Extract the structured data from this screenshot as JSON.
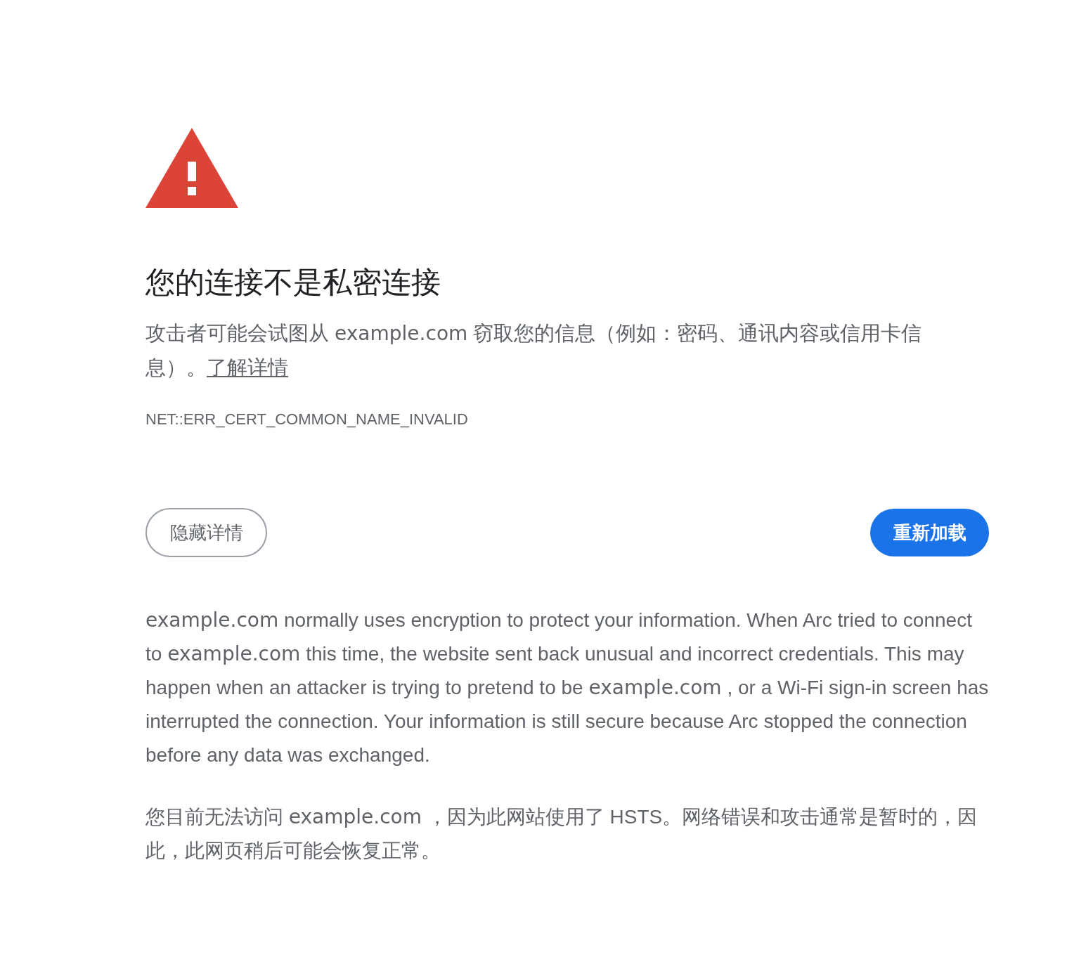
{
  "heading": "您的连接不是私密连接",
  "summary": {
    "parts": [
      {
        "kind": "text",
        "text": "攻击者可能会试图从"
      },
      {
        "kind": "domain",
        "text": "example.com"
      },
      {
        "kind": "text",
        "text": "窃取您的信息（例如：密码、通讯内容或信用卡信息）。"
      }
    ],
    "link": "了解详情"
  },
  "error_code": "NET::ERR_CERT_COMMON_NAME_INVALID",
  "buttons": [
    {
      "kind": "secondary",
      "label": "隐藏详情"
    },
    {
      "kind": "primary",
      "label": "重新加载"
    }
  ],
  "details": [
    {
      "parts": [
        {
          "kind": "domain",
          "text": "example.com"
        },
        {
          "kind": "text",
          "text": "normally uses encryption to protect your information. When Arc tried to connect to"
        },
        {
          "kind": "domain",
          "text": "example.com"
        },
        {
          "kind": "text",
          "text": "this time, the website sent back unusual and incorrect credentials. This may happen when an attacker is trying to pretend to be"
        },
        {
          "kind": "domain",
          "text": "example.com"
        },
        {
          "kind": "text",
          "text": ", or a Wi-Fi sign-in screen has interrupted the connection. Your information is still secure because Arc stopped the connection before any data was exchanged."
        }
      ]
    },
    {
      "parts": [
        {
          "kind": "text",
          "text": "您目前无法访问"
        },
        {
          "kind": "domain",
          "text": "example.com"
        },
        {
          "kind": "text",
          "text": "，因为此网站使用了 HSTS。网络错误和攻击通常是暂时的，因此，此网页稍后可能会恢复正常。"
        }
      ]
    }
  ]
}
